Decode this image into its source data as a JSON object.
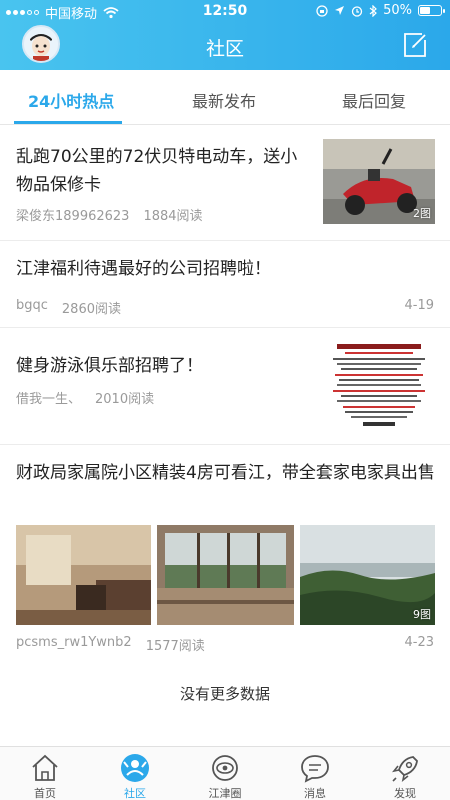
{
  "status_bar": {
    "carrier": "中国移动",
    "time": "12:50",
    "battery_text": "50%",
    "battery_level": 0.5
  },
  "nav": {
    "title": "社区",
    "avatar_icon": "cartoon-avatar-icon",
    "compose_icon": "compose-icon"
  },
  "tabs": [
    {
      "label": "24小时热点",
      "active": true
    },
    {
      "label": "最新发布",
      "active": false
    },
    {
      "label": "最后回复",
      "active": false
    }
  ],
  "posts": [
    {
      "title": "乱跑70公里的72伏贝特电动车，送小物品保修卡",
      "author": "梁俊东189962623",
      "reads": "1884阅读",
      "date": "",
      "image_count_badge": "2图"
    },
    {
      "title": "江津福利待遇最好的公司招聘啦！",
      "author": "bgqc",
      "reads": "2860阅读",
      "date": "4-19"
    },
    {
      "title": "健身游泳俱乐部招聘了！",
      "author": "借我一生、",
      "reads": "2010阅读",
      "date": ""
    },
    {
      "title": "财政局家属院小区精装4房可看江，带全套家电家具出售",
      "author": "pcsms_rw1Ywnb2",
      "reads": "1577阅读",
      "date": "4-23",
      "image_count_badge": "9图"
    }
  ],
  "footer_note": "没有更多数据",
  "bottom_tabs": [
    {
      "label": "首页",
      "icon": "home-icon",
      "active": false
    },
    {
      "label": "社区",
      "icon": "community-icon",
      "active": true
    },
    {
      "label": "江津圈",
      "icon": "circle-eye-icon",
      "active": false
    },
    {
      "label": "消息",
      "icon": "message-icon",
      "active": false
    },
    {
      "label": "发现",
      "icon": "rocket-icon",
      "active": false
    }
  ],
  "colors": {
    "accent": "#2ba8ea",
    "header_gradient_start": "#49c4ef",
    "header_gradient_end": "#2ba8ea"
  }
}
